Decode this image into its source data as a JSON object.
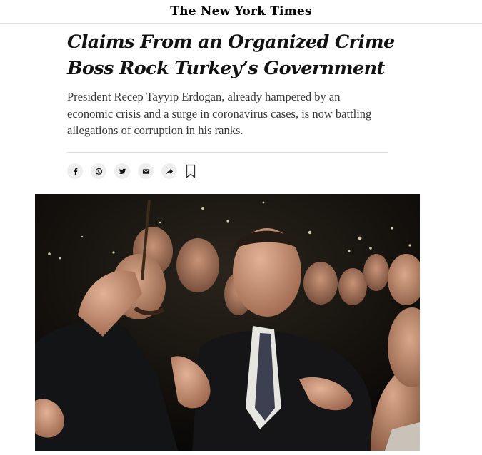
{
  "masthead": {
    "logo": "The New York Times"
  },
  "article": {
    "headline": "Claims From an Organized Crime Boss Rock Turkey’s Government",
    "summary": "President Recep Tayyip Erdogan, already hampered by an economic crisis and a surge in coronavirus cases, is now battling allegations of corruption in his ranks."
  },
  "share": {
    "buttons": [
      {
        "icon": "facebook-icon"
      },
      {
        "icon": "whatsapp-icon"
      },
      {
        "icon": "twitter-icon"
      },
      {
        "icon": "email-icon"
      },
      {
        "icon": "share-arrow-icon"
      }
    ],
    "save": {
      "icon": "bookmark-icon"
    }
  },
  "photo": {
    "subject": "lead-photo"
  }
}
